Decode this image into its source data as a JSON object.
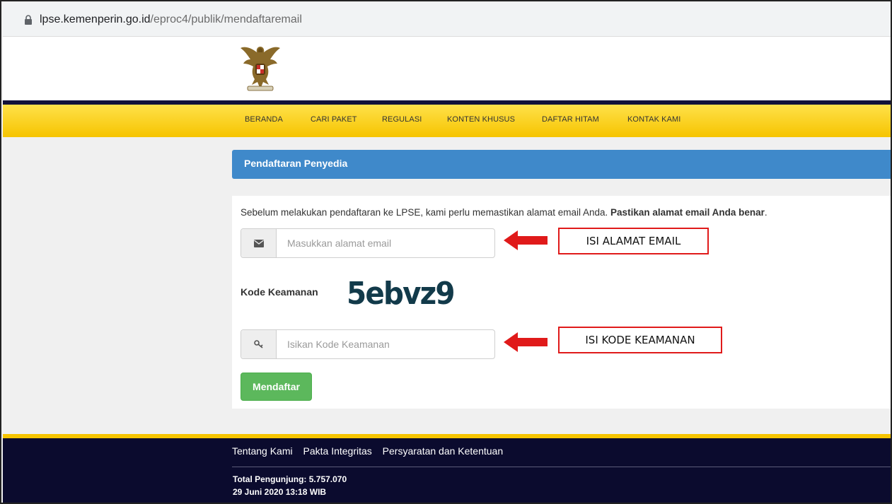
{
  "browser": {
    "url_host": "lpse.kemenperin.go.id",
    "url_path": "/eproc4/publik/mendaftaremail"
  },
  "nav": {
    "items": [
      "BERANDA",
      "CARI PAKET",
      "REGULASI",
      "KONTEN KHUSUS",
      "DAFTAR HITAM",
      "KONTAK KAMI"
    ]
  },
  "panel": {
    "title": "Pendaftaran Penyedia"
  },
  "form": {
    "intro_text": "Sebelum melakukan pendaftaran ke LPSE, kami perlu memastikan alamat email Anda.",
    "intro_bold": "Pastikan alamat email Anda benar",
    "intro_end": ".",
    "email_placeholder": "Masukkan alamat email",
    "kode_label": "Kode Keamanan",
    "captcha_text": "5ebvz9",
    "kode_placeholder": "Isikan Kode Keamanan",
    "submit_label": "Mendaftar"
  },
  "annotations": {
    "email": "ISI ALAMAT EMAIL",
    "kode": "ISI KODE KEAMANAN",
    "color": "#e01a1a"
  },
  "footer": {
    "links": [
      "Tentang Kami",
      "Pakta Integritas",
      "Persyaratan dan Ketentuan"
    ],
    "visitors": "Total Pengunjung: 5.757.070",
    "datetime": "29 Juni 2020 13:18 WIB"
  },
  "colors": {
    "nav_yellow": "#f6c400",
    "panel_blue": "#3f89ca",
    "button_green": "#5cb85c",
    "footer_navy": "#0b0b2e"
  }
}
